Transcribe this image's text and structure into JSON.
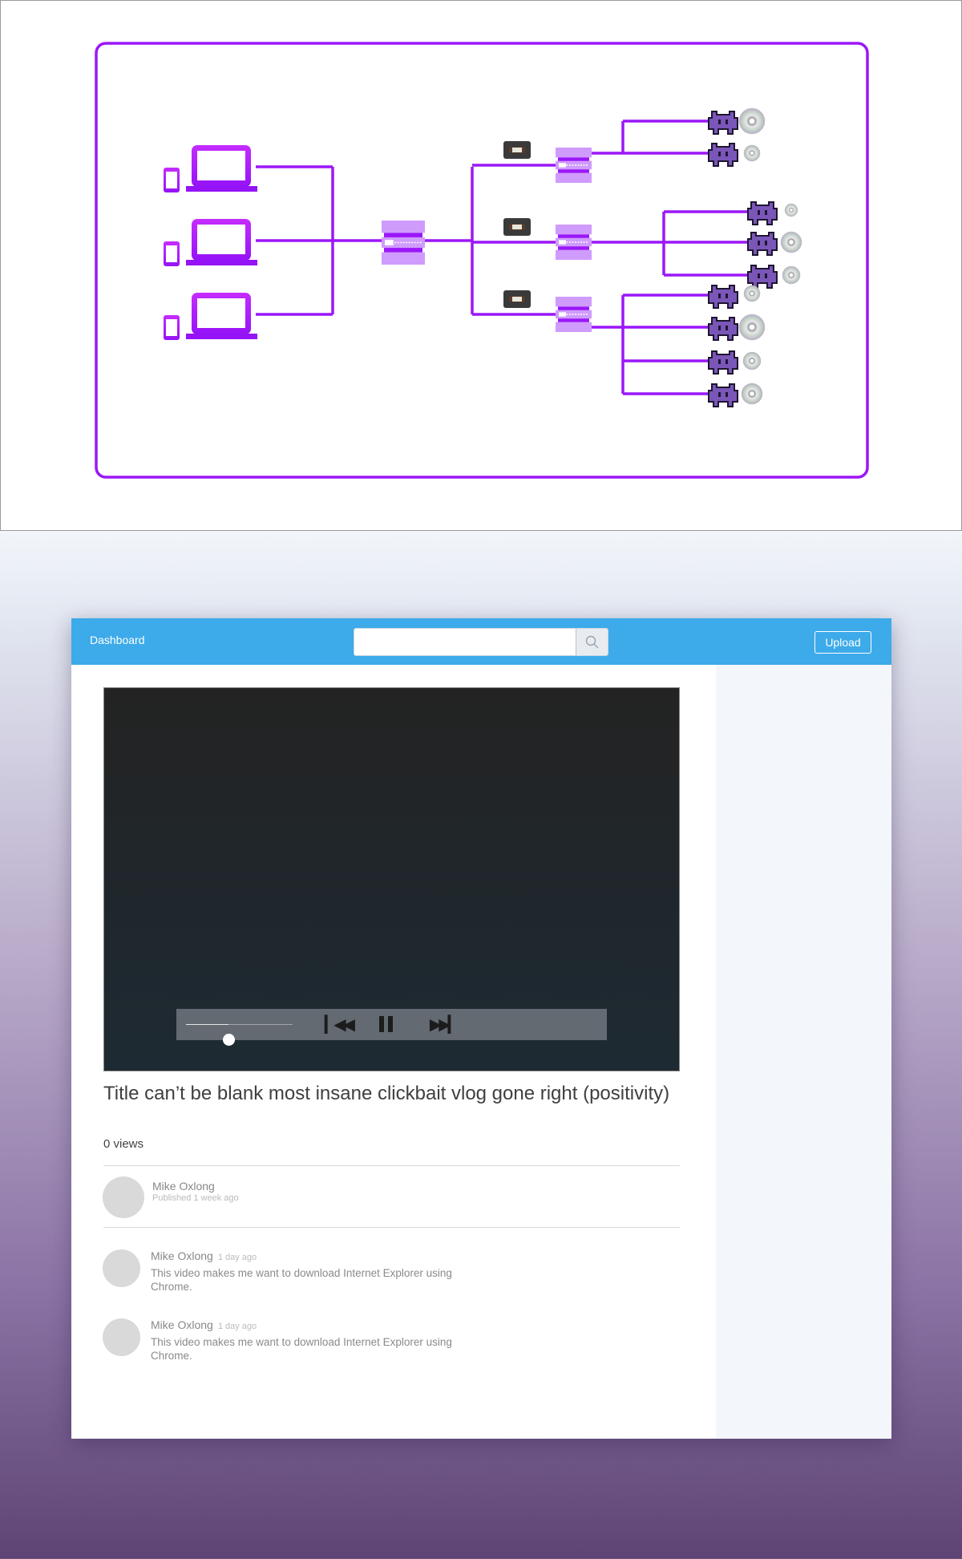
{
  "diagram": {
    "accent": "#9b17f8",
    "clients": 3,
    "servers": 3,
    "branch_counts": [
      2,
      3,
      4
    ]
  },
  "header": {
    "brand": "Dashboard",
    "search_placeholder": "",
    "upload_label": "Upload",
    "color": "#3daae9"
  },
  "player": {
    "progress_percent": 40,
    "state": "playing"
  },
  "video": {
    "title": "Title can’t be blank most insane clickbait vlog gone right (positivity)",
    "views": "0 views"
  },
  "author": {
    "name": "Mike Oxlong",
    "published": "Published 1 week ago"
  },
  "comments": [
    {
      "name": "Mike Oxlong",
      "time": "1 day ago",
      "text": "This video makes me want to download Internet Explorer using Chrome."
    },
    {
      "name": "Mike Oxlong",
      "time": "1 day ago",
      "text": "This video makes me want to download Internet Explorer using Chrome."
    }
  ]
}
